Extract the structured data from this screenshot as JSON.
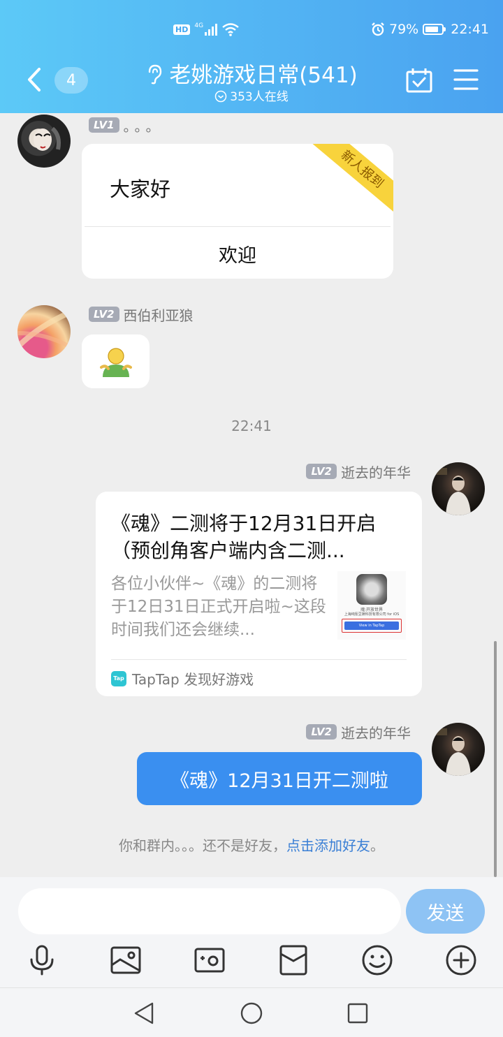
{
  "status_bar": {
    "network_badge": "HD",
    "signal_label": "4G",
    "battery_percent": "79%",
    "battery_level": 0.79,
    "time": "22:41"
  },
  "header": {
    "unread_count": "4",
    "group_title": "老姚游戏日常(541)",
    "online_text": "353人在线",
    "colors": {
      "gradient_start": "#5cc9f7",
      "gradient_end": "#4aa2f0"
    }
  },
  "messages": {
    "welcome": {
      "level": "LV1",
      "sender": "。。。",
      "text": "大家好",
      "ribbon": "新人报到",
      "button_label": "欢迎"
    },
    "emoji": {
      "level": "LV2",
      "sender": "西伯利亚狼",
      "emoji_name": "shrug-emoji"
    },
    "timestamp": "22:41",
    "share": {
      "level": "LV2",
      "sender": "逝去的年华",
      "title": "《魂》二测将于12月31日开启（预创角客户端内含二测...",
      "description": "各位小伙伴~《魂》的二测将于12日31日正式开启啦~这段时间我们还会继续...",
      "thumb_caption": "魂:开放世界",
      "thumb_company": "上海纯氪豆娱科技有限公司 for iOS",
      "thumb_button": "View in TapTap",
      "source_icon": "Tap",
      "source": "TapTap 发现好游戏"
    },
    "text_message": {
      "level": "LV2",
      "sender": "逝去的年华",
      "text": "《魂》12月31日开二测啦"
    }
  },
  "friend_notice": {
    "prefix": "你和群内。。。还不是好友，",
    "link": "点击添加好友",
    "suffix": "。"
  },
  "composer": {
    "input_value": "",
    "send_label": "发送",
    "colors": {
      "send_bg": "#8ec3f4",
      "my_bubble": "#3a8ff0"
    }
  }
}
